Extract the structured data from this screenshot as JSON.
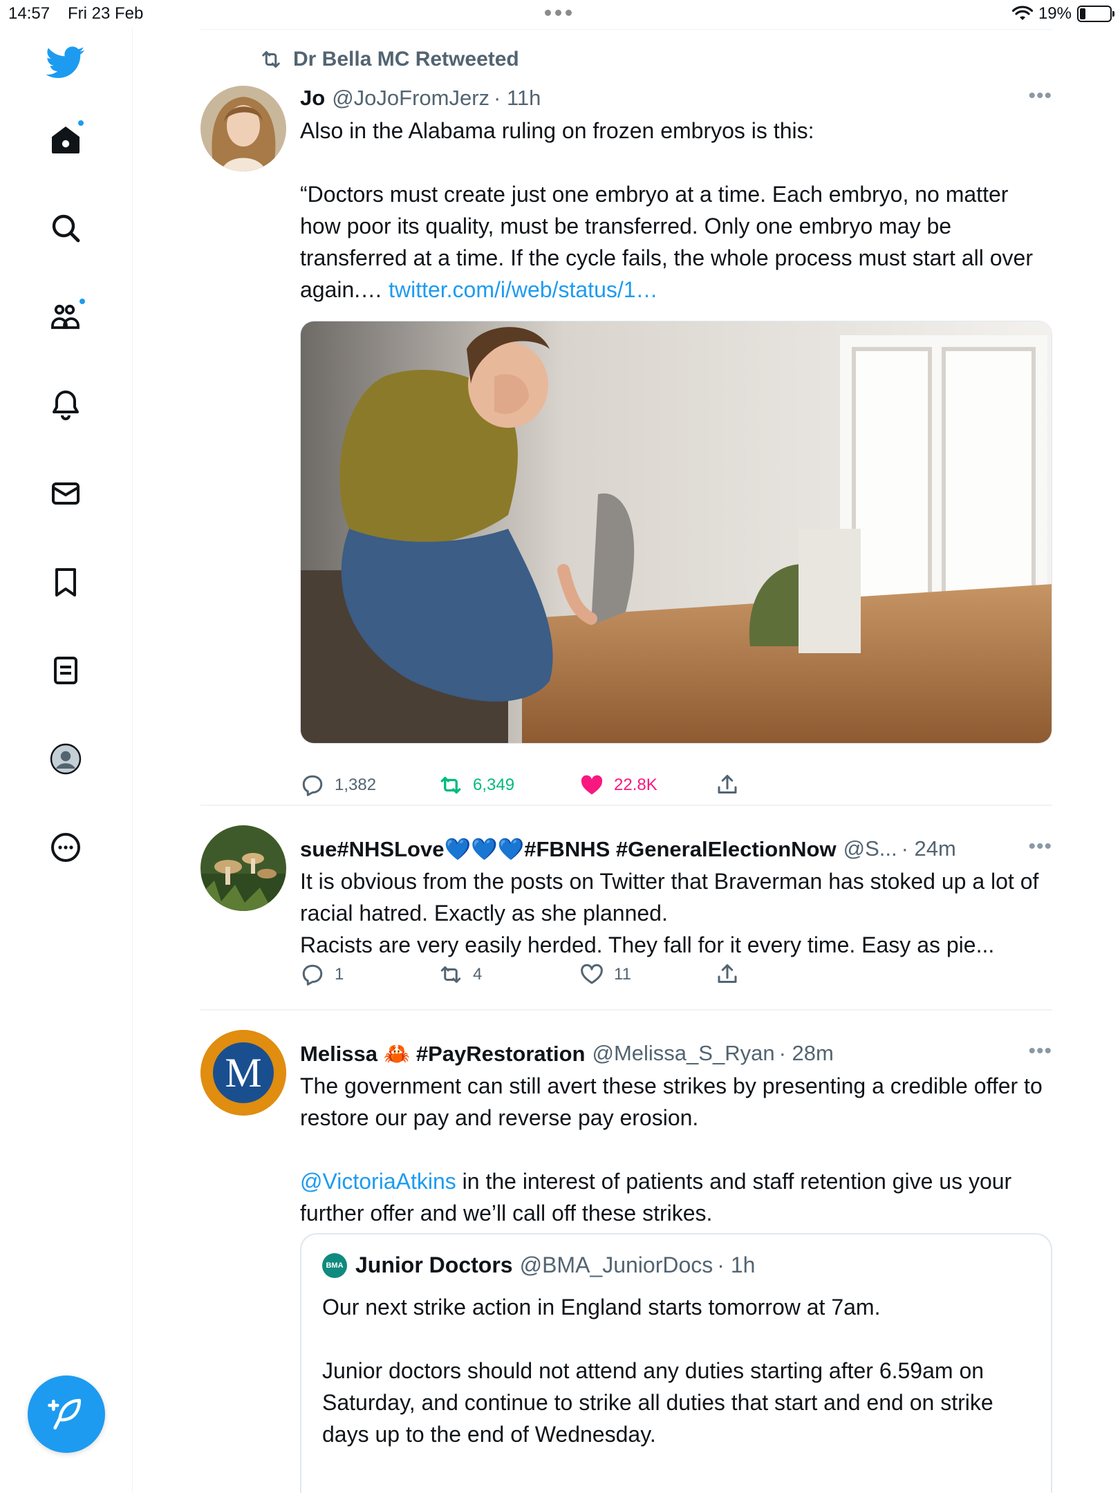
{
  "status_bar": {
    "time": "14:57",
    "date": "Fri 23 Feb",
    "battery": "19%",
    "battery_level": 0.19
  },
  "sidebar": {
    "items": [
      {
        "icon": "twitter-bird-icon",
        "label": "Twitter"
      },
      {
        "icon": "home-icon",
        "label": "Home"
      },
      {
        "icon": "search-icon",
        "label": "Explore"
      },
      {
        "icon": "communities-icon",
        "label": "Communities"
      },
      {
        "icon": "bell-icon",
        "label": "Notifications"
      },
      {
        "icon": "mail-icon",
        "label": "Messages"
      },
      {
        "icon": "bookmark-icon",
        "label": "Bookmarks"
      },
      {
        "icon": "lists-icon",
        "label": "Lists"
      },
      {
        "icon": "profile-icon",
        "label": "Profile"
      },
      {
        "icon": "more-icon",
        "label": "More"
      }
    ],
    "compose_icon": "compose-feather-icon",
    "accent": "#1d9bf0"
  },
  "tweets": [
    {
      "retweeted_by": "Dr Bella MC Retweeted",
      "name": "Jo",
      "handle": "@JoJoFromJerz",
      "time": "· 11h",
      "text": "Also in the Alabama ruling on frozen embryos is this:\n\n“Doctors must create just one embryo at a time. Each embryo, no matter how poor its quality, must be transferred. Only one embryo may be transferred at a time. If the cycle fails, the whole process must start all over again.… ",
      "link": "twitter.com/i/web/status/1…",
      "replies": "1,382",
      "retweets": "6,349",
      "likes": "22.8K"
    },
    {
      "name": "sue#NHSLove💙💙💙#FBNHS #GeneralElectionNow",
      "handle": "@S...",
      "time": "· 24m",
      "text": "It is obvious from the posts on Twitter that Braverman has stoked up a lot of racial hatred. Exactly as she planned.\nRacists are very easily herded. They fall for it every time. Easy as pie...",
      "replies": "1",
      "retweets": "4",
      "likes": "11"
    },
    {
      "name": "Melissa 🦀 #PayRestoration",
      "handle": "@Melissa_S_Ryan",
      "time": "· 28m",
      "avatar_letter": "M",
      "text1": "The government can still avert these strikes by presenting a credible offer to restore our pay and reverse pay erosion.",
      "mention": "@VictoriaAtkins",
      "text2": " in the interest of patients and staff retention give us your further offer and we’ll call off these strikes.",
      "quote": {
        "avatar_text": "BMA",
        "name": "Junior Doctors",
        "handle": "@BMA_JuniorDocs",
        "time": "· 1h",
        "text": "Our next strike action in England starts tomorrow at 7am.\n\nJunior doctors should not attend any duties starting after 6.59am on Saturday, and continue to strike all duties that start and end on strike days up to the end of Wednesday."
      }
    }
  ]
}
